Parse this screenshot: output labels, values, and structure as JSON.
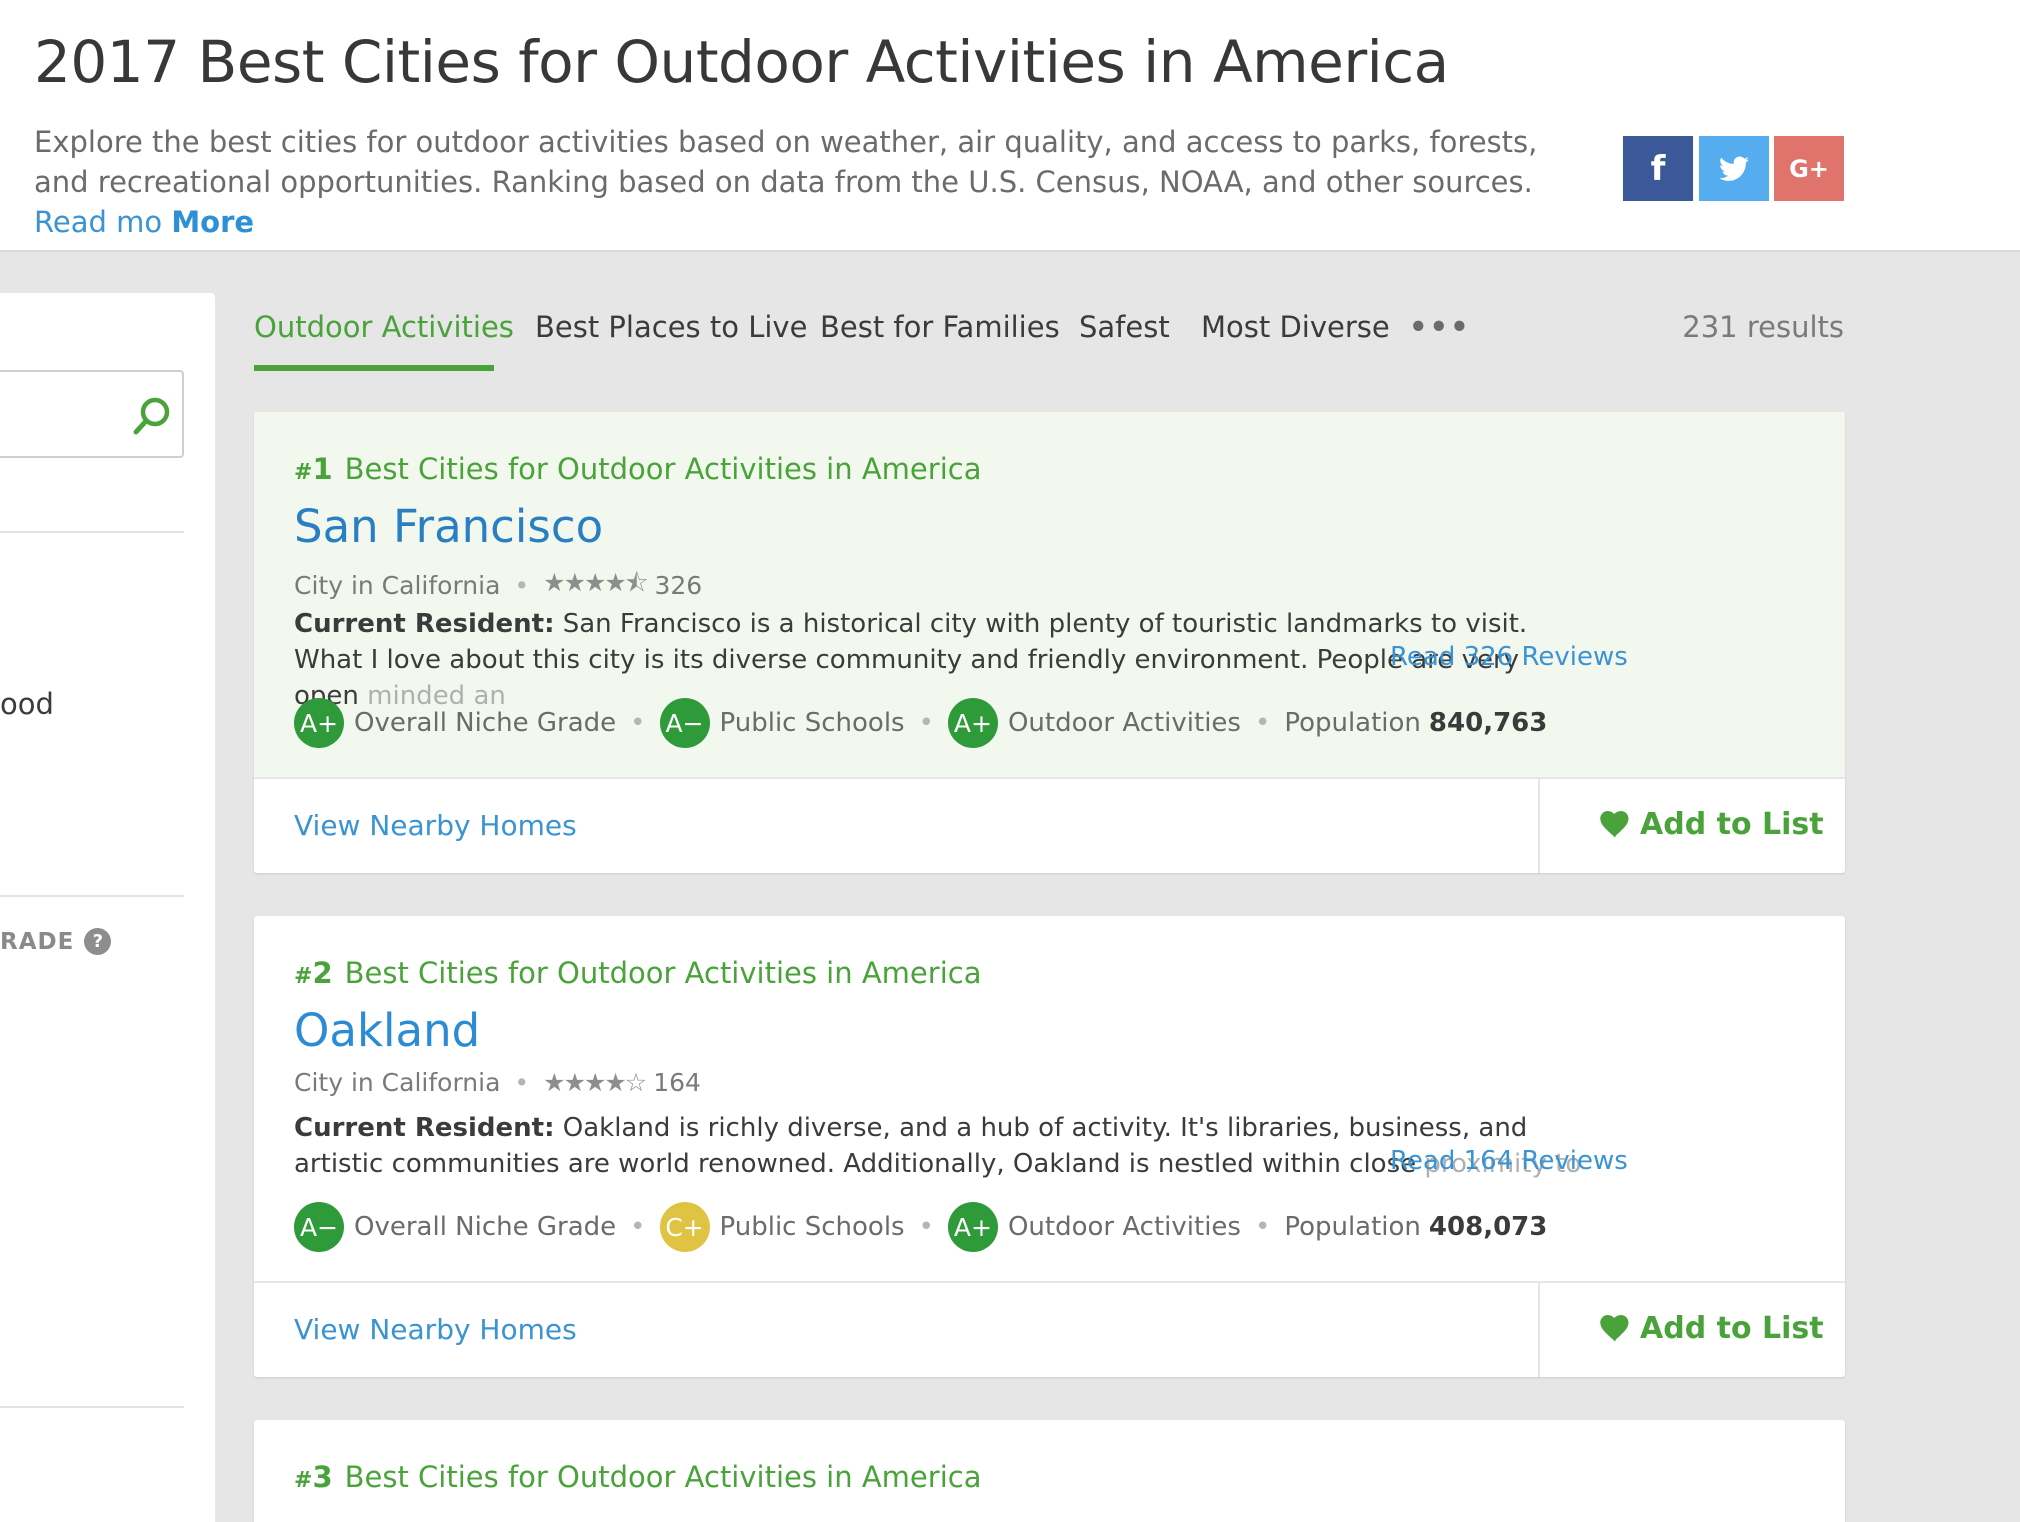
{
  "header": {
    "title": "2017 Best Cities for Outdoor Activities in America",
    "description": "Explore the best cities for outdoor activities based on weather, air quality, and access to parks, forests, and recreational opportunities. Ranking based on data from the U.S. Census, NOAA, and other sources.",
    "read_more": "Read mo",
    "more": "More",
    "share": {
      "facebook": "f",
      "google_plus": "G+"
    }
  },
  "sidebar": {
    "partial_text": "ood",
    "grade_label": "RADE",
    "help": "?"
  },
  "tabs": [
    {
      "label": "Outdoor Activities"
    },
    {
      "label": "Best Places to Live"
    },
    {
      "label": "Best for Families"
    },
    {
      "label": "Safest"
    },
    {
      "label": "Most Diverse"
    }
  ],
  "tabs_more": "•••",
  "results": "231 results",
  "cards": [
    {
      "hash": "#",
      "rank": "1",
      "ranking": "Best Cities for Outdoor Activities in America",
      "name": "San Francisco",
      "type": "City in California",
      "stars": "★★★★⯪",
      "rating": 4.5,
      "review_count": "326",
      "review_label": "Current Resident:",
      "review_text": "San Francisco is a historical city with plenty of touristic landmarks to visit. What I love about this city is its diverse community and friendly environment. People are very open",
      "review_fade": "minded an",
      "read_reviews": "Read 326 Reviews",
      "grades": [
        {
          "grade": "A+",
          "label": "Overall Niche Grade",
          "color": "#2f9a3a"
        },
        {
          "grade": "A−",
          "label": "Public Schools",
          "color": "#2f9a3a"
        },
        {
          "grade": "A+",
          "label": "Outdoor Activities",
          "color": "#2f9a3a"
        }
      ],
      "population_label": "Population",
      "population": "840,763",
      "nearby": "View Nearby Homes",
      "add_list": "Add to List"
    },
    {
      "hash": "#",
      "rank": "2",
      "ranking": "Best Cities for Outdoor Activities in America",
      "name": "Oakland",
      "type": "City in California",
      "stars": "★★★★☆",
      "rating": 4,
      "review_count": "164",
      "review_label": "Current Resident:",
      "review_text": "Oakland is richly diverse, and a hub of activity. It's libraries, business, and artistic communities are world renowned. Additionally, Oakland is nestled within close",
      "review_fade": "proximity to",
      "read_reviews": "Read 164 Reviews",
      "grades": [
        {
          "grade": "A−",
          "label": "Overall Niche Grade",
          "color": "#2f9a3a"
        },
        {
          "grade": "C+",
          "label": "Public Schools",
          "color": "#e0c342"
        },
        {
          "grade": "A+",
          "label": "Outdoor Activities",
          "color": "#2f9a3a"
        }
      ],
      "population_label": "Population",
      "population": "408,073",
      "nearby": "View Nearby Homes",
      "add_list": "Add to List"
    },
    {
      "hash": "#",
      "rank": "3",
      "ranking": "Best Cities for Outdoor Activities in America"
    }
  ]
}
